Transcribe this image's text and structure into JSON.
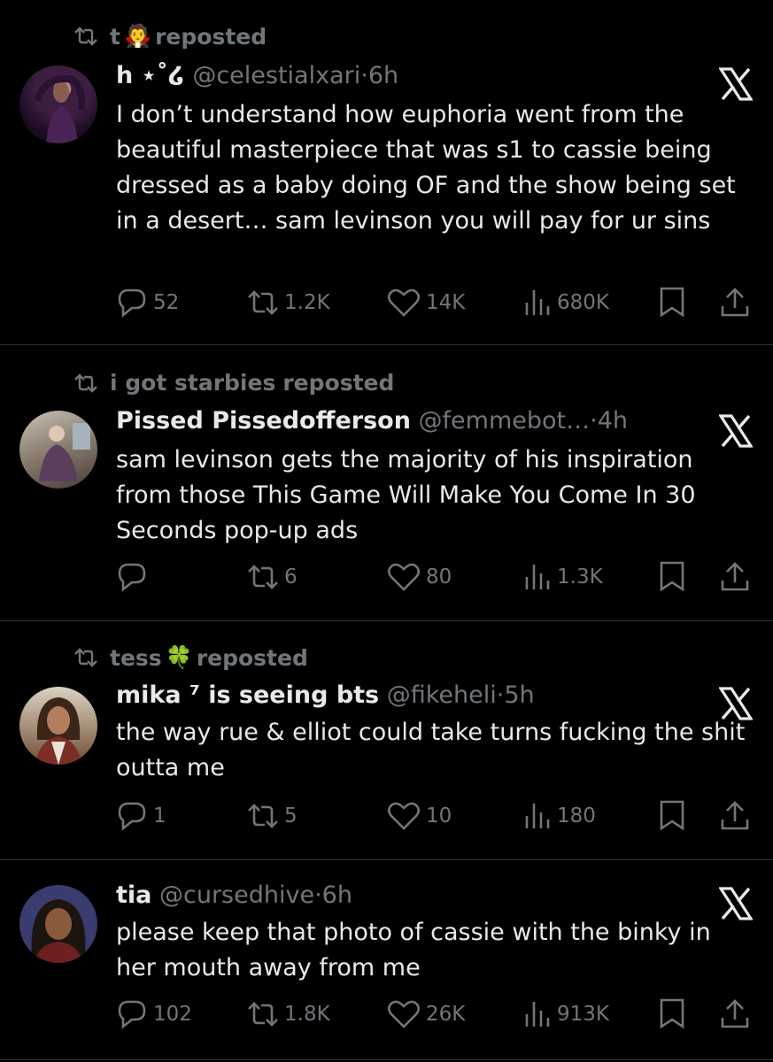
{
  "colors": {
    "background": "#000000",
    "text": "#e7e9ea",
    "secondary": "#71767b",
    "divider": "#2f3336"
  },
  "tweets": [
    {
      "repost": {
        "user": "t",
        "label": "reposted",
        "emoji": "🧛"
      },
      "name": "h ⋆˚໒",
      "handle": "@celestialxari",
      "sep": "·",
      "time": "6h",
      "text": "I don’t understand how euphoria went from the beautiful masterpiece that was s1 to cassie being dressed as a baby doing OF and the show being set in a desert… sam levinson you will pay for ur sins",
      "stats": {
        "replies": "52",
        "reposts": "1.2K",
        "likes": "14K",
        "views": "680K"
      }
    },
    {
      "repost": {
        "user": "i got starbies",
        "label": "reposted",
        "emoji": ""
      },
      "name": "Pissed Pissedofferson",
      "handle": "@femmebot…",
      "sep": "·",
      "time": "4h",
      "text": "sam levinson gets the majority of his inspiration from those This Game Will Make You Come In 30 Seconds pop-up ads",
      "stats": {
        "replies": "",
        "reposts": "6",
        "likes": "80",
        "views": "1.3K"
      }
    },
    {
      "repost": {
        "user": "tess",
        "label": "reposted",
        "emoji": "🍀"
      },
      "name": "mika ⁷ is seeing bts",
      "handle": "@fikeheli",
      "sep": "·",
      "time": "5h",
      "text": "the way rue & elliot could take turns fucking the shit outta me",
      "stats": {
        "replies": "1",
        "reposts": "5",
        "likes": "10",
        "views": "180"
      }
    },
    {
      "repost": null,
      "name": "tia",
      "handle": "@cursedhive",
      "sep": "·",
      "time": "6h",
      "text": "please keep that photo of cassie with the binky in her mouth away from me",
      "stats": {
        "replies": "102",
        "reposts": "1.8K",
        "likes": "26K",
        "views": "913K"
      }
    }
  ]
}
